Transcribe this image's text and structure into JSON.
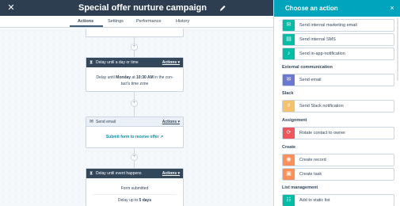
{
  "header": {
    "title": "Special offer nurture campaign",
    "close_icon": "close-icon",
    "edit_icon": "pencil-icon"
  },
  "tabs": [
    {
      "label": "Actions",
      "active": true
    },
    {
      "label": "Settings",
      "active": false
    },
    {
      "label": "Performance",
      "active": false
    },
    {
      "label": "History",
      "active": false
    }
  ],
  "workflow": {
    "delay_card": {
      "title": "Delay until a day or time",
      "actions": "Actions ▾",
      "line1_pre": "Delay until ",
      "line1_bold": "Monday",
      "line1_mid": " at ",
      "line1_bold2": "10:30 AM",
      "line1_post": " in the con-",
      "line2": "tact's time zone"
    },
    "email_card": {
      "title": "Send email",
      "actions": "Actions ▾",
      "link": "Submit form to receive offer"
    },
    "event_card": {
      "title": "Delay until event happens",
      "actions": "Actions ▾",
      "line1": "Form submitted",
      "line2_pre": "Delay up to ",
      "line2_bold": "5 days"
    }
  },
  "panel": {
    "title": "Choose an action",
    "close": "×",
    "items_top": [
      {
        "label": "Send internal marketing email",
        "color": "#00bda5",
        "icon": "mail-icon"
      },
      {
        "label": "Send internal SMS",
        "color": "#00bda5",
        "icon": "sms-icon"
      },
      {
        "label": "Send in-app-notification",
        "color": "#00bda5",
        "icon": "bell-icon"
      }
    ],
    "sections": [
      {
        "title": "External communication",
        "items": [
          {
            "label": "Send email",
            "color": "#6a78d1",
            "icon": "mail-icon"
          }
        ]
      },
      {
        "title": "Slack",
        "items": [
          {
            "label": "Send Slack notification",
            "color": "#f5c26b",
            "icon": "slack-icon"
          }
        ]
      },
      {
        "title": "Assignment",
        "items": [
          {
            "label": "Rotate contact to owner",
            "color": "#f2545b",
            "icon": "rotate-icon"
          }
        ]
      },
      {
        "title": "Create",
        "items": [
          {
            "label": "Create record",
            "color": "#ff8f59",
            "icon": "record-icon"
          },
          {
            "label": "Create task",
            "color": "#ff8f59",
            "icon": "task-icon"
          }
        ]
      },
      {
        "title": "List management",
        "items": [
          {
            "label": "Add to static list",
            "color": "#00bda5",
            "icon": "list-icon"
          }
        ]
      }
    ]
  }
}
